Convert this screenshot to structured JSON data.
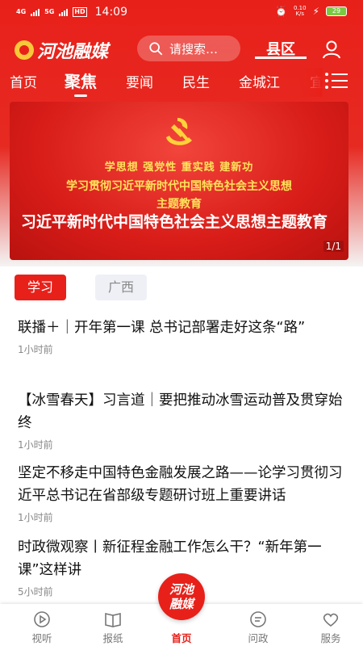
{
  "status": {
    "network1": "4G",
    "network2": "5G",
    "hd": "HD",
    "time": "14:09",
    "speed_value": "0.10",
    "speed_unit": "K/s",
    "battery": "29"
  },
  "header": {
    "logo_text": "河池融媒",
    "search_placeholder": "请搜索…",
    "county_label": "县区"
  },
  "tabs": [
    {
      "label": "首页"
    },
    {
      "label": "聚焦"
    },
    {
      "label": "要闻"
    },
    {
      "label": "民生"
    },
    {
      "label": "金城江"
    },
    {
      "label": "宜"
    }
  ],
  "banner": {
    "slogan": "学思想  强党性  重实践  建新功",
    "subtitle_line1": "学习贯彻习近平新时代中国特色社会主义思想",
    "subtitle_line2": "主题教育",
    "caption": "习近平新时代中国特色社会主义思想主题教育",
    "pager": "1/1"
  },
  "chips": [
    {
      "label": "学习"
    },
    {
      "label": "广西"
    }
  ],
  "news": [
    {
      "title": "联播＋｜开年第一课 总书记部署走好这条“路”",
      "time": "1小时前"
    },
    {
      "title": "【冰雪春天】习言道｜要把推动冰雪运动普及贯穿始终",
      "time": "1小时前"
    },
    {
      "title": "坚定不移走中国特色金融发展之路——论学习贯彻习近平总书记在省部级专题研讨班上重要讲话",
      "time": "1小时前"
    },
    {
      "title": "时政微观察丨新征程金融工作怎么干？“新年第一课”这样讲",
      "time": "5小时前"
    }
  ],
  "bottom_nav": {
    "listen": "视听",
    "newspaper": "报纸",
    "home_badge": "河池融媒",
    "home": "首页",
    "politics": "问政",
    "service": "服务"
  },
  "colors": {
    "brand_red": "#e8201a",
    "banner_gold": "#ffe35a"
  }
}
